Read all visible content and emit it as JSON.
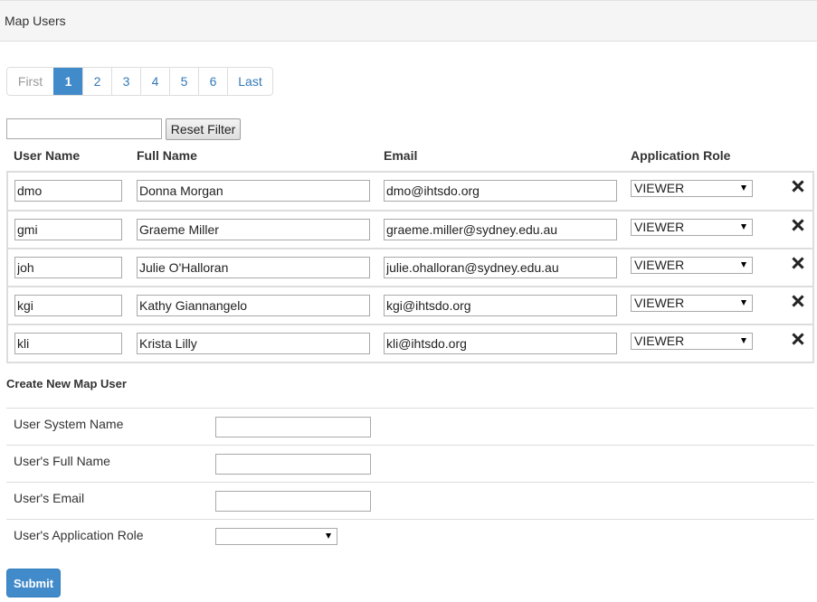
{
  "panel": {
    "title": "Map Users"
  },
  "pagination": {
    "items": [
      {
        "label": "First",
        "state": "disabled"
      },
      {
        "label": "1",
        "state": "active"
      },
      {
        "label": "2",
        "state": "normal"
      },
      {
        "label": "3",
        "state": "normal"
      },
      {
        "label": "4",
        "state": "normal"
      },
      {
        "label": "5",
        "state": "normal"
      },
      {
        "label": "6",
        "state": "normal"
      },
      {
        "label": "Last",
        "state": "normal"
      }
    ]
  },
  "filter": {
    "value": "",
    "reset_label": "Reset Filter"
  },
  "table": {
    "headers": [
      "User Name",
      "Full Name",
      "Email",
      "Application Role"
    ],
    "rows": [
      {
        "user_name": "dmo",
        "full_name": "Donna Morgan",
        "email": "dmo@ihtsdo.org",
        "role": "VIEWER"
      },
      {
        "user_name": "gmi",
        "full_name": "Graeme Miller",
        "email": "graeme.miller@sydney.edu.au",
        "role": "VIEWER"
      },
      {
        "user_name": "joh",
        "full_name": "Julie O'Halloran",
        "email": "julie.ohalloran@sydney.edu.au",
        "role": "VIEWER"
      },
      {
        "user_name": "kgi",
        "full_name": "Kathy Giannangelo",
        "email": "kgi@ihtsdo.org",
        "role": "VIEWER"
      },
      {
        "user_name": "kli",
        "full_name": "Krista Lilly",
        "email": "kli@ihtsdo.org",
        "role": "VIEWER"
      }
    ],
    "remove_icon": "close-icon"
  },
  "create": {
    "title": "Create New Map User",
    "fields": [
      {
        "label": "User System Name",
        "type": "input",
        "value": ""
      },
      {
        "label": "User's Full Name",
        "type": "input",
        "value": ""
      },
      {
        "label": "User's Email",
        "type": "input",
        "value": ""
      },
      {
        "label": "User's Application Role",
        "type": "select",
        "value": ""
      }
    ],
    "submit_label": "Submit"
  },
  "colors": {
    "accent": "#428bca",
    "link": "#337ab7",
    "border": "#dddddd"
  }
}
